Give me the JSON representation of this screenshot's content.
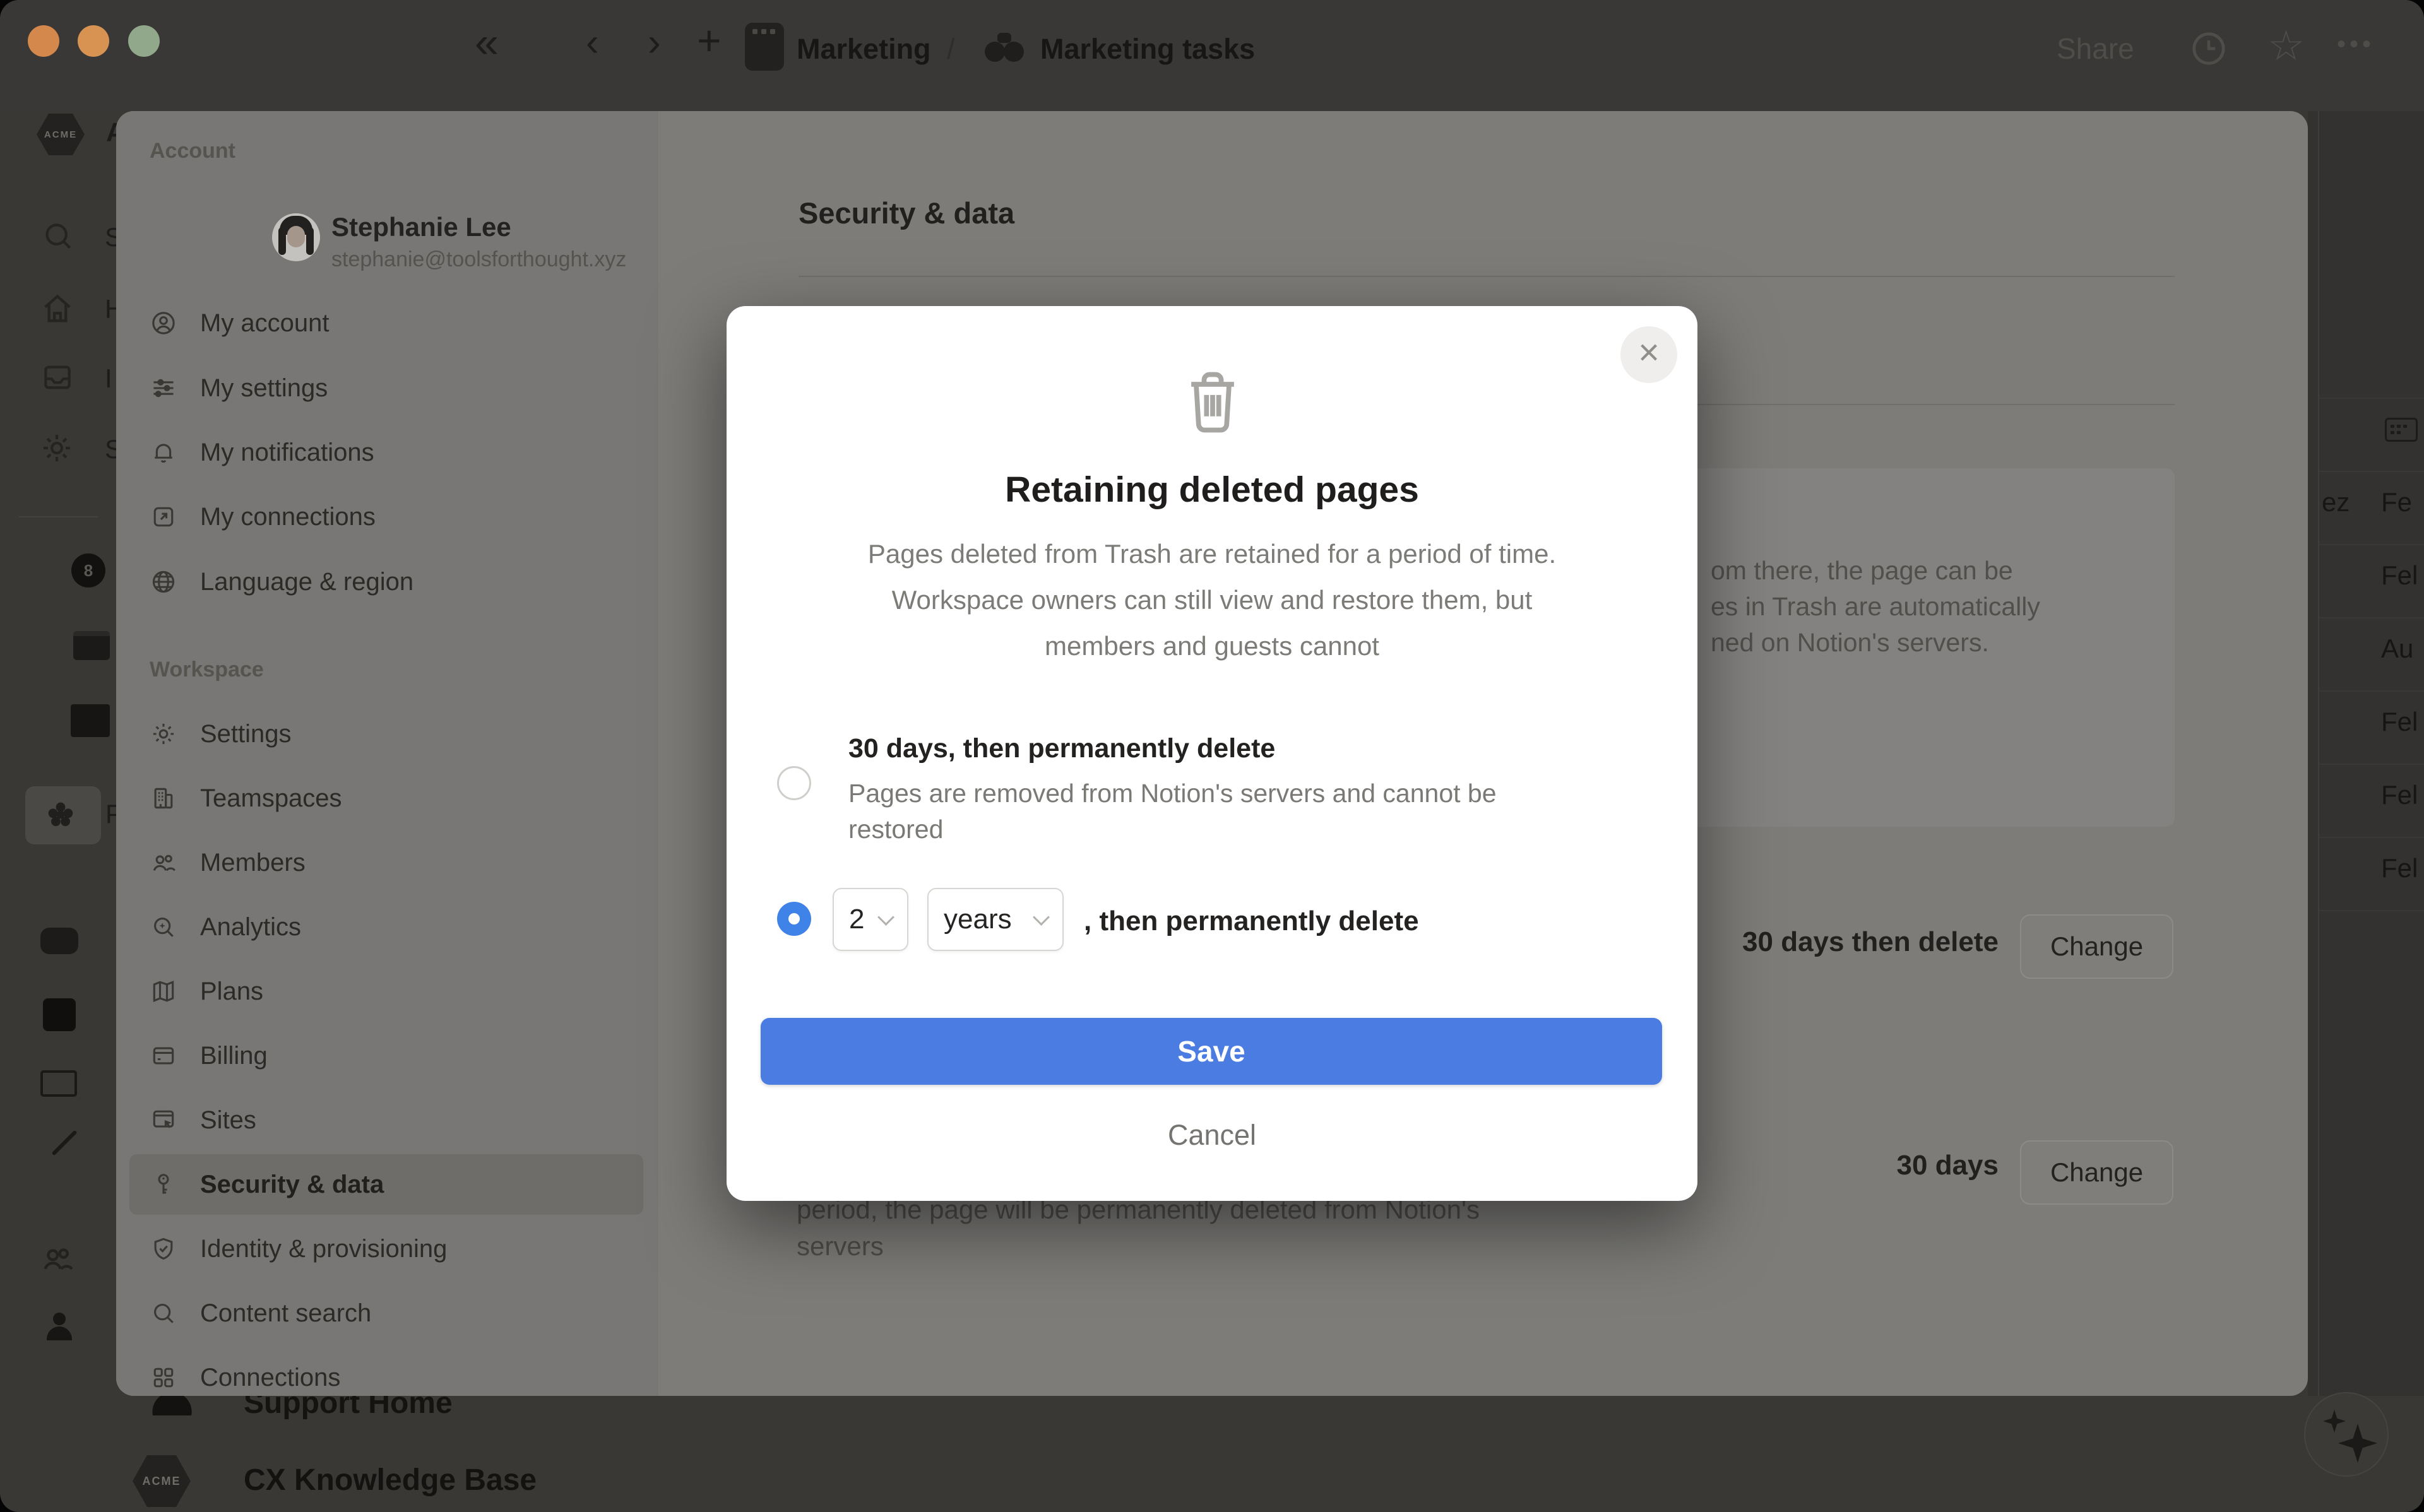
{
  "topbar": {
    "collapse": "«",
    "back": "‹",
    "forward": "›",
    "plus": "+",
    "breadcrumb_parent": "Marketing",
    "breadcrumb_sep": "/",
    "breadcrumb_page": "Marketing tasks",
    "share": "Share",
    "star": "☆",
    "more": "•••"
  },
  "app_sidebar": {
    "workspace_logo": "ACME",
    "eight_ball": "8",
    "fragments": [
      "A",
      "S",
      "H",
      "I",
      "S",
      "P"
    ]
  },
  "settings": {
    "account_label": "Account",
    "profile": {
      "name": "Stephanie Lee",
      "email": "stephanie@toolsforthought.xyz"
    },
    "account_items": [
      {
        "label": "My account"
      },
      {
        "label": "My settings"
      },
      {
        "label": "My notifications"
      },
      {
        "label": "My connections"
      },
      {
        "label": "Language & region"
      }
    ],
    "workspace_label": "Workspace",
    "workspace_items": [
      {
        "label": "Settings"
      },
      {
        "label": "Teamspaces"
      },
      {
        "label": "Members"
      },
      {
        "label": "Analytics"
      },
      {
        "label": "Plans"
      },
      {
        "label": "Billing"
      },
      {
        "label": "Sites"
      },
      {
        "label": "Security & data"
      },
      {
        "label": "Identity & provisioning"
      },
      {
        "label": "Content search"
      },
      {
        "label": "Connections"
      }
    ],
    "content": {
      "heading": "Security & data",
      "card_lines": [
        "om there, the page can be",
        "es in Trash are automatically",
        "ned on Notion's servers."
      ],
      "rows": [
        {
          "value": "30 days then delete",
          "button": "Change"
        },
        {
          "value": "30 days",
          "button": "Change"
        }
      ],
      "footer_lines": [
        "period, the page will be permanently deleted from Notion's",
        "servers"
      ]
    }
  },
  "table_fragment": {
    "name_fragment": "ez",
    "dates": [
      "Fe",
      "Fel",
      "Au",
      "Fel",
      "Fel",
      "Fel"
    ]
  },
  "dialog": {
    "close": "×",
    "title": "Retaining deleted pages",
    "body_lines": [
      "Pages deleted from Trash are retained for a period of time.",
      "Workspace owners can still view and restore them, but",
      "members and guests cannot"
    ],
    "option_30": {
      "label": "30 days, then permanently delete",
      "desc_lines": [
        "Pages are removed from Notion's servers and cannot be",
        "restored"
      ]
    },
    "option_custom": {
      "count": "2",
      "unit": "years",
      "suffix": ", then permanently delete"
    },
    "save": "Save",
    "cancel": "Cancel"
  },
  "dock": {
    "pawn": "♟",
    "support": "Support Home",
    "kb": "CX Knowledge Base"
  },
  "colors": {
    "accent_blue": "#4b7ce2",
    "radio_blue": "#3f82e8"
  }
}
